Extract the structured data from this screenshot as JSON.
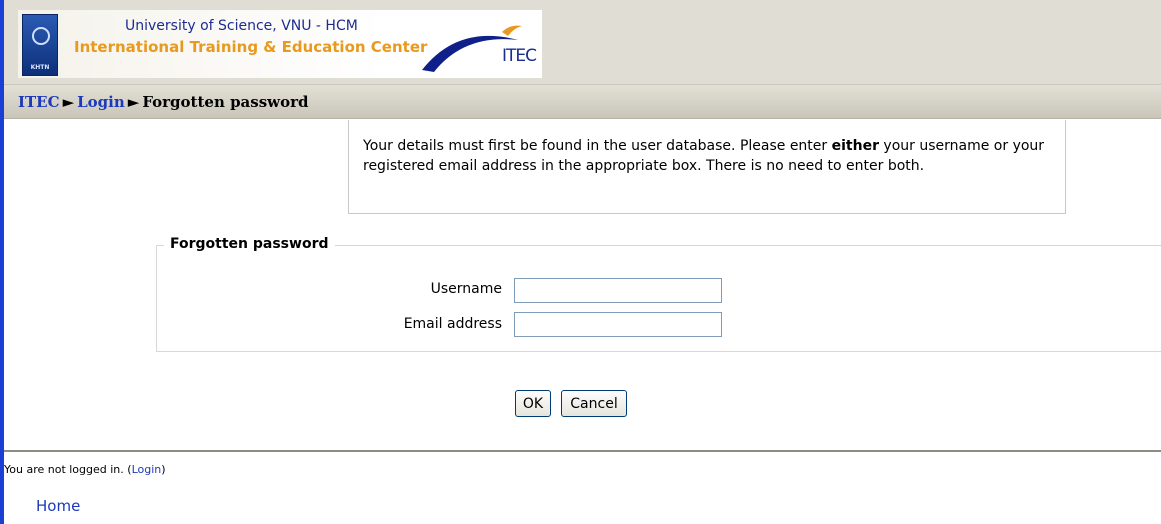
{
  "header": {
    "university": "University of Science, VNU - HCM",
    "center": "International Training & Education Center",
    "logo_text": "ITEC",
    "emblem_caption": "KHTN"
  },
  "breadcrumb": {
    "home": "ITEC",
    "separator": "►",
    "login": "Login",
    "current": "Forgotten password"
  },
  "instructions": {
    "before": "Your details must first be found in the user database. Please enter ",
    "emphasis": "either",
    "after": " your username or your registered email address in the appropriate box. There is no need to enter both."
  },
  "form": {
    "legend": "Forgotten password",
    "username_label": "Username",
    "username_value": "",
    "email_label": "Email address",
    "email_value": "",
    "ok_label": "OK",
    "cancel_label": "Cancel"
  },
  "footer": {
    "status_prefix": "You are not logged in. (",
    "login_link": "Login",
    "status_suffix": ")",
    "home_link": "Home"
  },
  "colors": {
    "link": "#1c39bb",
    "nav_bar": "#d3cfc4",
    "accent_blue_rule": "#1a3fd4",
    "center_orange": "#e79a1f"
  }
}
